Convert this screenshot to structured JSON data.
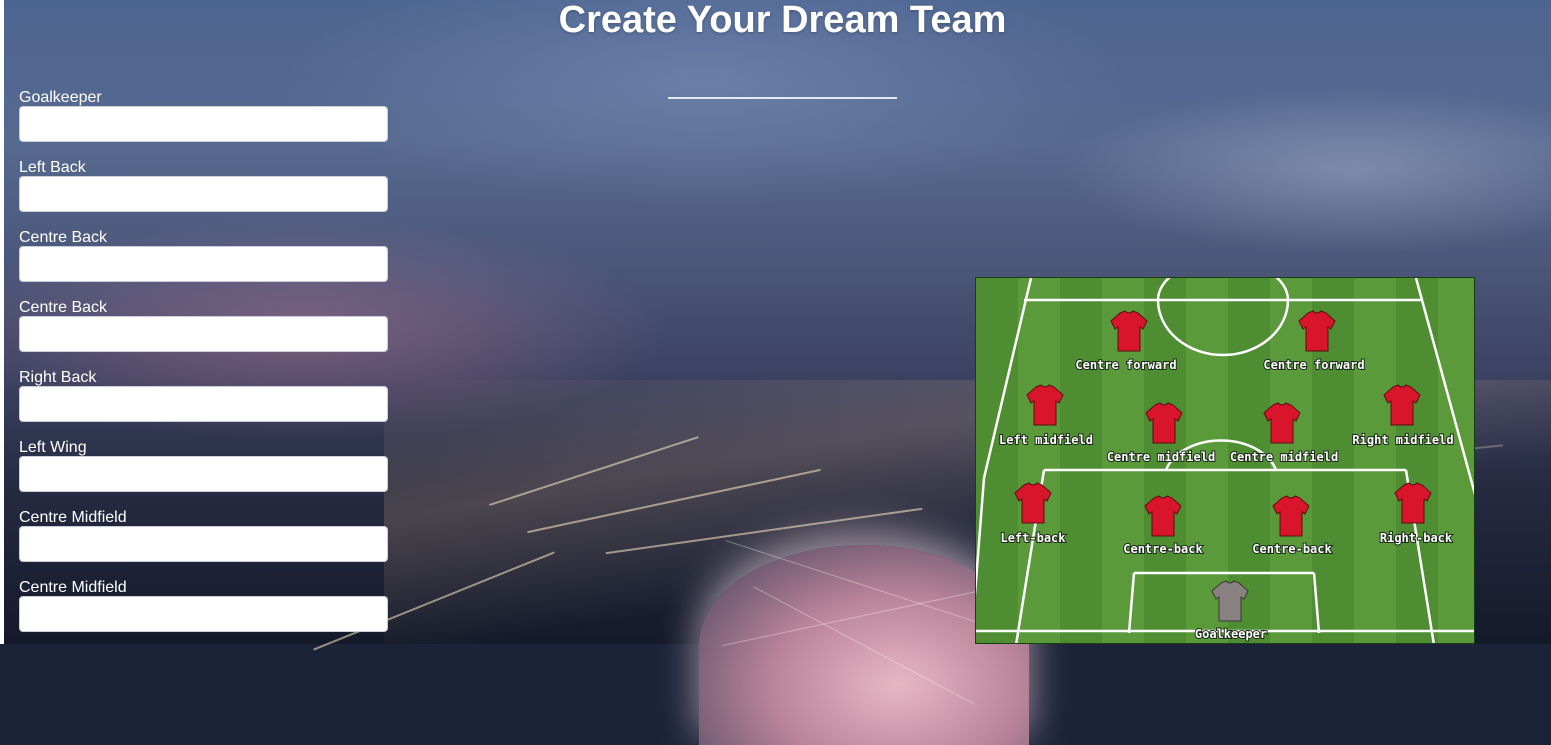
{
  "header": {
    "title": "Create Your Dream Team"
  },
  "form": {
    "fields": [
      {
        "label": "Goalkeeper",
        "value": ""
      },
      {
        "label": "Left Back",
        "value": ""
      },
      {
        "label": "Centre Back",
        "value": ""
      },
      {
        "label": "Centre Back",
        "value": ""
      },
      {
        "label": "Right Back",
        "value": ""
      },
      {
        "label": "Left Wing",
        "value": ""
      },
      {
        "label": "Centre Midfield",
        "value": ""
      },
      {
        "label": "Centre Midfield",
        "value": ""
      }
    ]
  },
  "formation": {
    "players": [
      {
        "label": "Centre forward",
        "kit": "red"
      },
      {
        "label": "Centre forward",
        "kit": "red"
      },
      {
        "label": "Left midfield",
        "kit": "red"
      },
      {
        "label": "Centre midfield",
        "kit": "red"
      },
      {
        "label": "Centre midfield",
        "kit": "red"
      },
      {
        "label": "Right midfield",
        "kit": "red"
      },
      {
        "label": "Left-back",
        "kit": "red"
      },
      {
        "label": "Centre-back",
        "kit": "red"
      },
      {
        "label": "Centre-back",
        "kit": "red"
      },
      {
        "label": "Right-back",
        "kit": "red"
      },
      {
        "label": "Goalkeeper",
        "kit": "grey"
      }
    ],
    "colors": {
      "grass_light": "#5a9a3a",
      "grass_dark": "#4f8d33",
      "kit_red": "#d9152b",
      "kit_grey": "#8a8282",
      "lines": "#ffffff"
    }
  },
  "icons": {
    "jersey": "jersey-icon"
  }
}
